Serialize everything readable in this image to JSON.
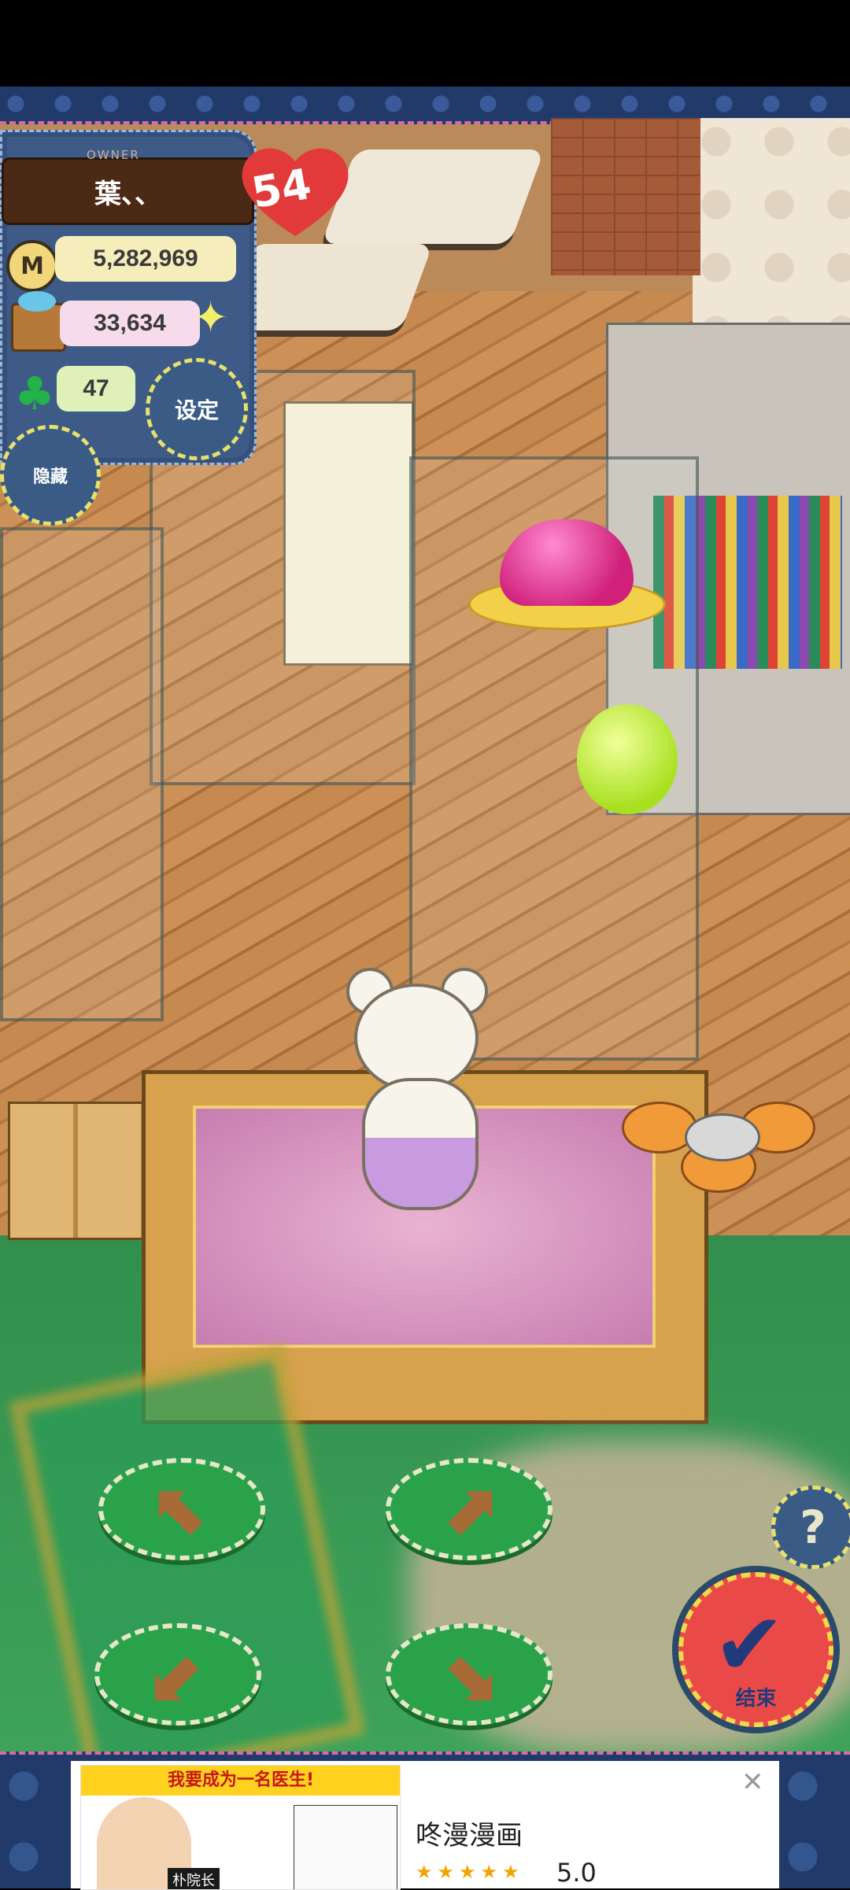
{
  "hud": {
    "owner_label": "OWNER",
    "player_name": "葉、、",
    "hearts": "54",
    "coins": "5,282,969",
    "goods": "33,634",
    "clovers": "47",
    "settings_label": "设定",
    "hide_label": "隐藏"
  },
  "controls": {
    "arrows": [
      {
        "name": "arrow-up-left-button",
        "glyph": "⬉"
      },
      {
        "name": "arrow-up-right-button",
        "glyph": "⬈"
      },
      {
        "name": "arrow-down-left-button",
        "glyph": "⬋"
      },
      {
        "name": "arrow-down-right-button",
        "glyph": "⬊"
      }
    ],
    "help_label": "?",
    "end_label": "结束",
    "end_icon": "checkmark-icon"
  },
  "ad": {
    "banner_text": "我要成为一名医生!",
    "tag_text": "朴院长",
    "app_name": "咚漫漫画",
    "rating": "5.0",
    "stars": "★★★★★",
    "close_icon": "close-icon"
  },
  "colors": {
    "hud_blue": "#3d5b86",
    "heart_red": "#e23a3a",
    "end_red": "#e94a48",
    "arrow_green": "#2aa24a"
  }
}
